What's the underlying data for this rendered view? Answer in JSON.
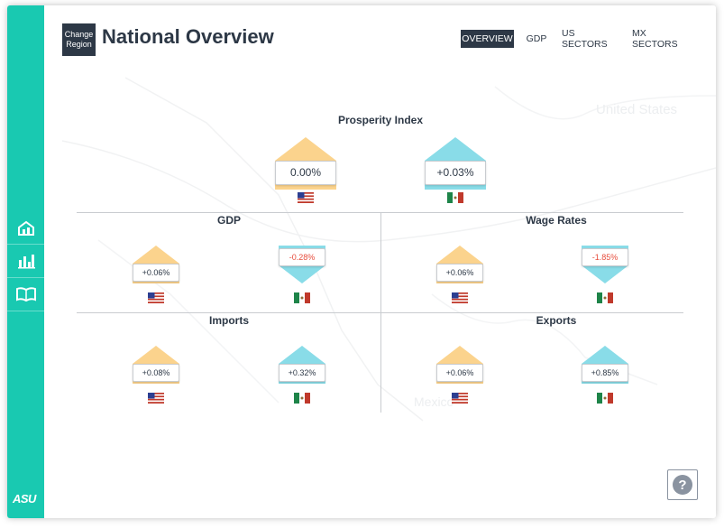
{
  "header": {
    "change_region_label": "Change Region",
    "title": "National Overview"
  },
  "nav": [
    "OVERVIEW",
    "GDP",
    "US SECTORS",
    "MX SECTORS"
  ],
  "map_labels": {
    "us": "United States",
    "mx": "Mexico"
  },
  "sidebar": {
    "icons": [
      "overview-icon",
      "sectors-chart-icon",
      "book-icon"
    ],
    "logo": "ASU"
  },
  "sections": {
    "prosperity": {
      "title": "Prosperity Index",
      "us": "0.00%",
      "mx": "+0.03%"
    },
    "gdp": {
      "title": "GDP",
      "us": "+0.06%",
      "mx": "-0.28%"
    },
    "wage": {
      "title": "Wage Rates",
      "us": "+0.06%",
      "mx": "-1.85%"
    },
    "imports": {
      "title": "Imports",
      "us": "+0.08%",
      "mx": "+0.32%"
    },
    "exports": {
      "title": "Exports",
      "us": "+0.06%",
      "mx": "+0.85%"
    }
  },
  "colors": {
    "teal": "#19c9b1",
    "navy": "#2d3846",
    "us_arrow": "#fbd38d",
    "mx_arrow": "#89dce8",
    "negative": "#e74c3c"
  }
}
